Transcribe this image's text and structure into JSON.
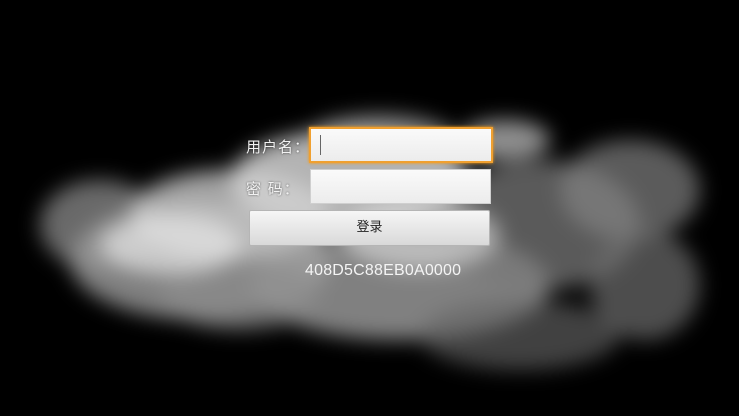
{
  "login": {
    "username_label": "用户名：",
    "username_value": "",
    "password_label": "密 码：",
    "password_value": "",
    "submit_label": "登录",
    "device_id": "408D5C88EB0A0000"
  },
  "theme": {
    "background": "#000000",
    "focus_border": "#f0a030",
    "text": "#f2f2f2"
  }
}
